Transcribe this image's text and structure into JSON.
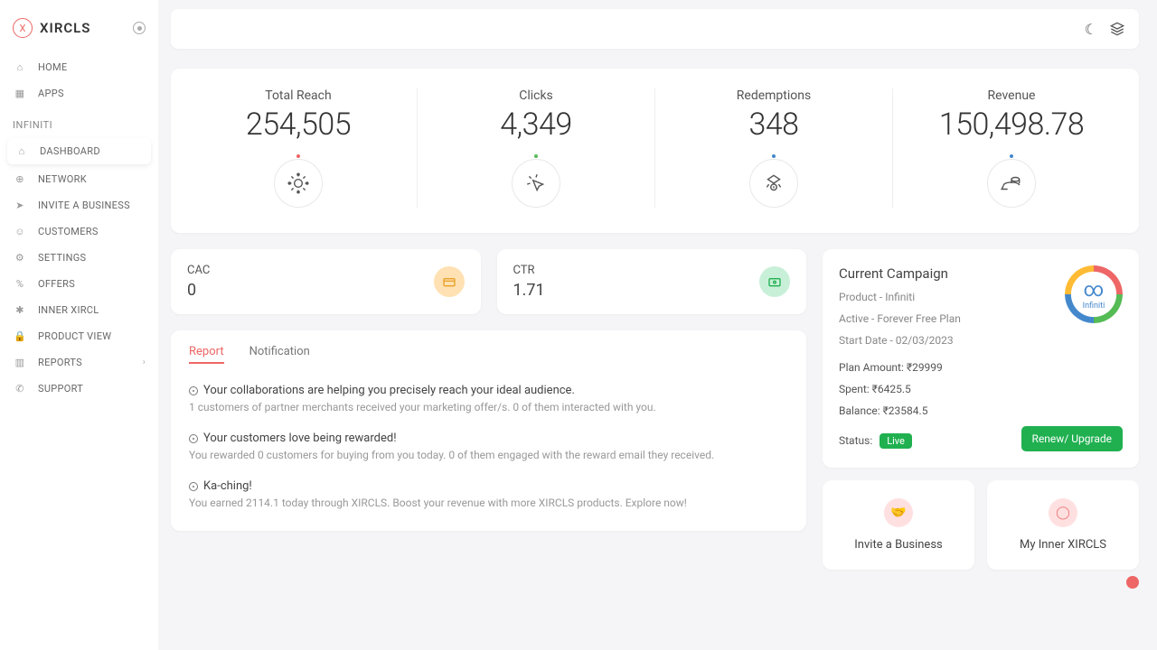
{
  "brand": "XIRCLS",
  "nav": {
    "home": "HOME",
    "apps": "APPS",
    "section": "INFINITI",
    "dashboard": "DASHBOARD",
    "network": "NETWORK",
    "invite": "INVITE A BUSINESS",
    "customers": "CUSTOMERS",
    "settings": "SETTINGS",
    "offers": "OFFERS",
    "inner": "INNER XIRCL",
    "product_view": "PRODUCT VIEW",
    "reports": "REPORTS",
    "support": "SUPPORT"
  },
  "metrics": {
    "reach_label": "Total Reach",
    "reach_value": "254,505",
    "clicks_label": "Clicks",
    "clicks_value": "4,349",
    "redemptions_label": "Redemptions",
    "redemptions_value": "348",
    "revenue_label": "Revenue",
    "revenue_value": "150,498.78"
  },
  "small": {
    "cac_label": "CAC",
    "cac_value": "0",
    "ctr_label": "CTR",
    "ctr_value": "1.71"
  },
  "tabs": {
    "report": "Report",
    "notification": "Notification"
  },
  "reports": [
    {
      "title": "Your collaborations are helping you precisely reach your ideal audience.",
      "desc": "1 customers of partner merchants received your marketing offer/s. 0 of them interacted with you."
    },
    {
      "title": "Your customers love being rewarded!",
      "desc": "You rewarded 0 customers for buying from you today. 0 of them engaged with the reward email they received."
    },
    {
      "title": "Ka-ching!",
      "desc": "You earned 2114.1 today through XIRCLS. Boost your revenue with more XIRCLS products. Explore now!"
    }
  ],
  "campaign": {
    "title": "Current Campaign",
    "product": "Product - Infiniti",
    "plan": "Active - Forever Free Plan",
    "start": "Start Date - 02/03/2023",
    "plan_amount": "Plan Amount: ₹29999",
    "spent": "Spent: ₹6425.5",
    "balance": "Balance: ₹23584.5",
    "status_label": "Status:",
    "status_value": "Live",
    "renew": "Renew/ Upgrade",
    "logo_label": "Infiniti"
  },
  "actions": {
    "invite": "Invite a Business",
    "inner": "My Inner XIRCLS"
  }
}
